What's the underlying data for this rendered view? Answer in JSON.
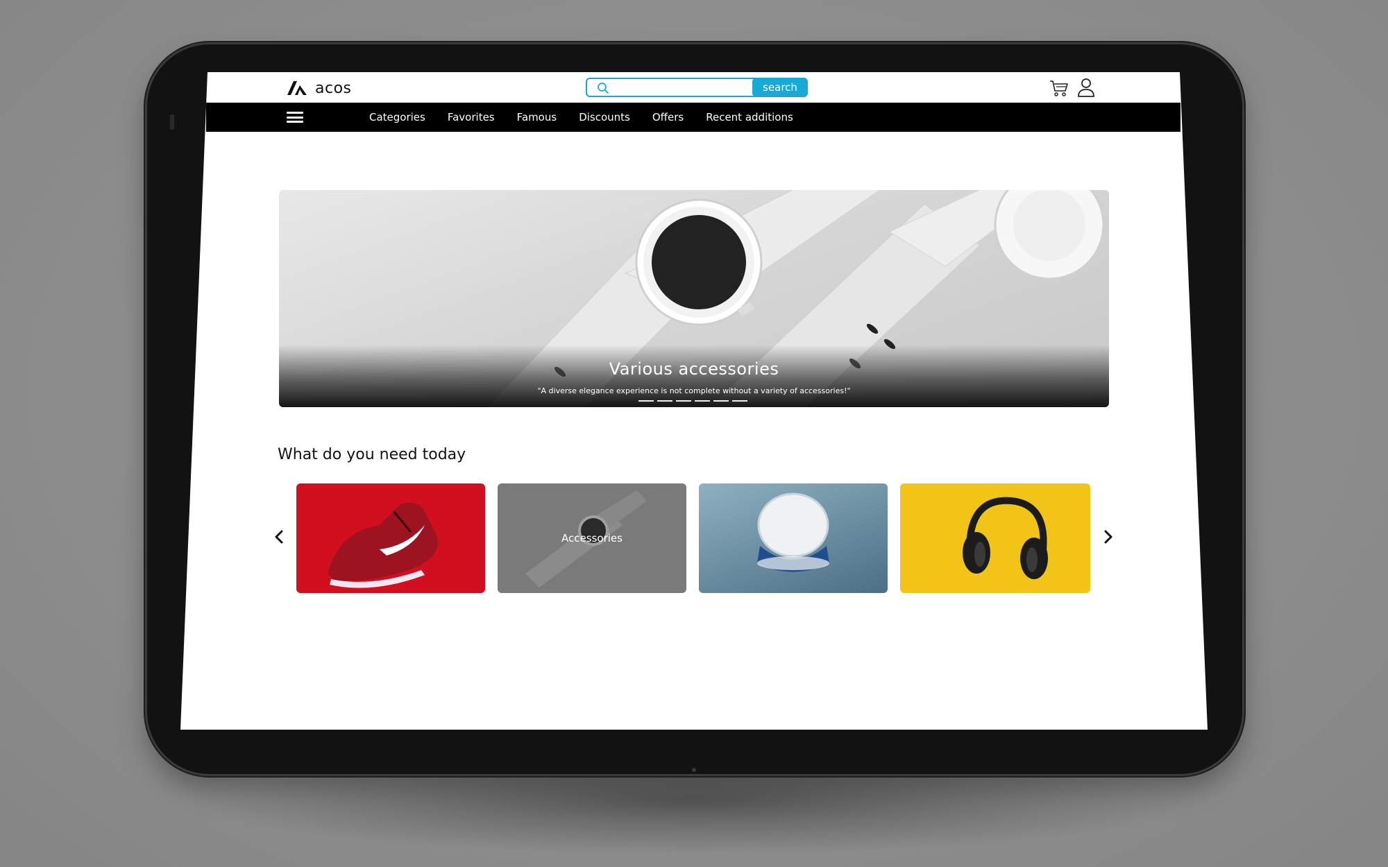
{
  "header": {
    "logo_text": "acos",
    "search": {
      "placeholder": "",
      "value": "",
      "button_label": "search"
    },
    "icons": [
      "cart-icon",
      "user-icon",
      "search-icon"
    ]
  },
  "navbar": {
    "menu_icon": "hamburger-menu-icon",
    "items": [
      {
        "label": "Categories"
      },
      {
        "label": "Favorites"
      },
      {
        "label": "Famous"
      },
      {
        "label": "Discounts"
      },
      {
        "label": "Offers"
      },
      {
        "label": "Recent additions"
      }
    ]
  },
  "hero": {
    "title": "Various accessories",
    "subtitle": "\"A diverse elegance experience is not complete without a variety of accessories!\"",
    "slide_count": 6
  },
  "section": {
    "title": "What do you need today",
    "cards": [
      {
        "label": "",
        "image": "red-sneaker",
        "bg": "#d10f1f"
      },
      {
        "label": "Accessories",
        "image": "smartwatch",
        "bg": "#7a7a7a"
      },
      {
        "label": "",
        "image": "cosmetics-jar",
        "bg": "#5f8397"
      },
      {
        "label": "",
        "image": "headphones",
        "bg": "#f2c418"
      }
    ]
  },
  "colors": {
    "accent": "#18a9d6",
    "navbar": "#000000",
    "device": "#121212"
  }
}
